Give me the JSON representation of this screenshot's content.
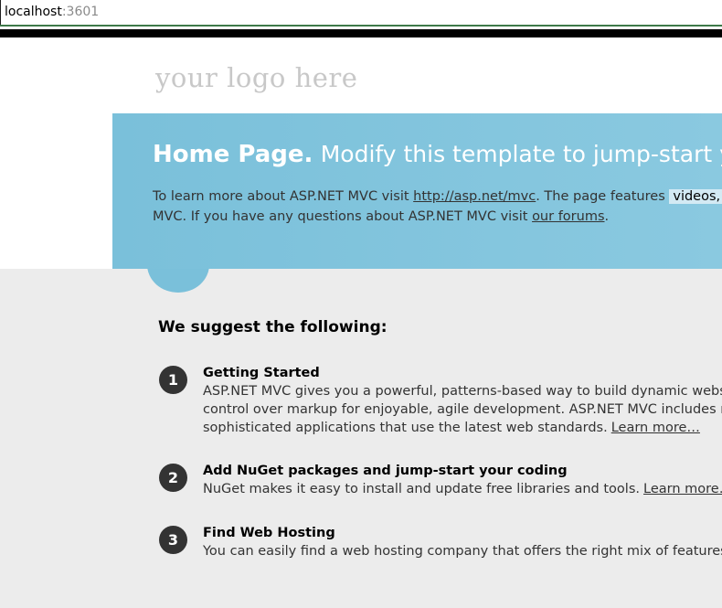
{
  "browser": {
    "address_host": "localhost",
    "address_port": ":3601"
  },
  "header": {
    "logo_text": "your logo here"
  },
  "featured": {
    "title_bold": "Home Page.",
    "title_rest": "Modify this template to jump-start your",
    "line1_pre": "To learn more about ASP.NET MVC visit ",
    "line1_link": "http://asp.net/mvc",
    "line1_mid": ". The page features ",
    "line1_mark": "videos, tuto",
    "line2_pre": "MVC. If you have any questions about ASP.NET MVC visit ",
    "line2_link": "our forums",
    "line2_post": "."
  },
  "main": {
    "heading": "We suggest the following:",
    "steps": [
      {
        "number": "1",
        "title": "Getting Started",
        "line1": "ASP.NET MVC gives you a powerful, patterns-based way to build dynamic websites tha",
        "line2": "control over markup for enjoyable, agile development. ASP.NET MVC includes many fe",
        "line3": "sophisticated applications that use the latest web standards.",
        "link": "Learn more…"
      },
      {
        "number": "2",
        "title": "Add NuGet packages and jump-start your coding",
        "line1": "NuGet makes it easy to install and update free libraries and tools.",
        "link": "Learn more…"
      },
      {
        "number": "3",
        "title": "Find Web Hosting",
        "line1": "You can easily find a web hosting company that offers the right mix of features and pr"
      }
    ]
  },
  "colors": {
    "featured_blue": "#7ac0da",
    "main_grey": "#ececec",
    "step_circle": "#333333"
  }
}
